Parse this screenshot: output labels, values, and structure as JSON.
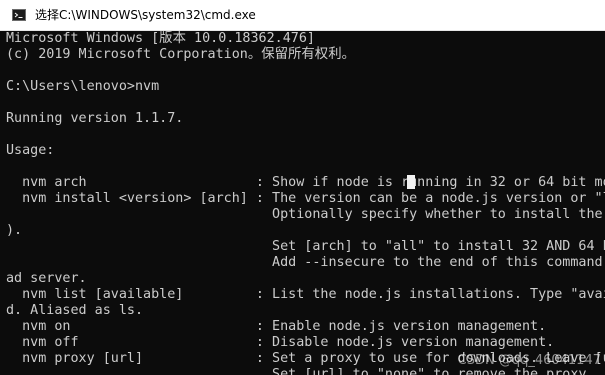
{
  "window": {
    "title": "选择C:\\WINDOWS\\system32\\cmd.exe",
    "icon": "cmd-console-icon"
  },
  "console": {
    "colors": {
      "background": "#0c0c0c",
      "text": "#cccccc",
      "cursor": "#f2f2f2"
    },
    "lines": [
      "Microsoft Windows [版本 10.0.18362.476]",
      "(c) 2019 Microsoft Corporation。保留所有权利。",
      "",
      "C:\\Users\\lenovo>nvm",
      "",
      "Running version 1.1.7.",
      "",
      "Usage:",
      "",
      "  nvm arch                     : Show if node is running in 32 or 64 bit mo",
      "  nvm install <version> [arch] : The version can be a node.js version or \"l",
      "                                 Optionally specify whether to install the ",
      ").",
      "                                 Set [arch] to \"all\" to install 32 AND 64 b",
      "                                 Add --insecure to the end of this command ",
      "ad server.",
      "  nvm list [available]         : List the node.js installations. Type \"avai",
      "d. Aliased as ls.",
      "  nvm on                       : Enable node.js version management.",
      "  nvm off                      : Disable node.js version management.",
      "  nvm proxy [url]              : Set a proxy to use for downloads. Leave [u",
      "                                 Set [url] to \"none\" to remove the proxy."
    ]
  },
  "watermark": "CSDN @qq_46041147"
}
